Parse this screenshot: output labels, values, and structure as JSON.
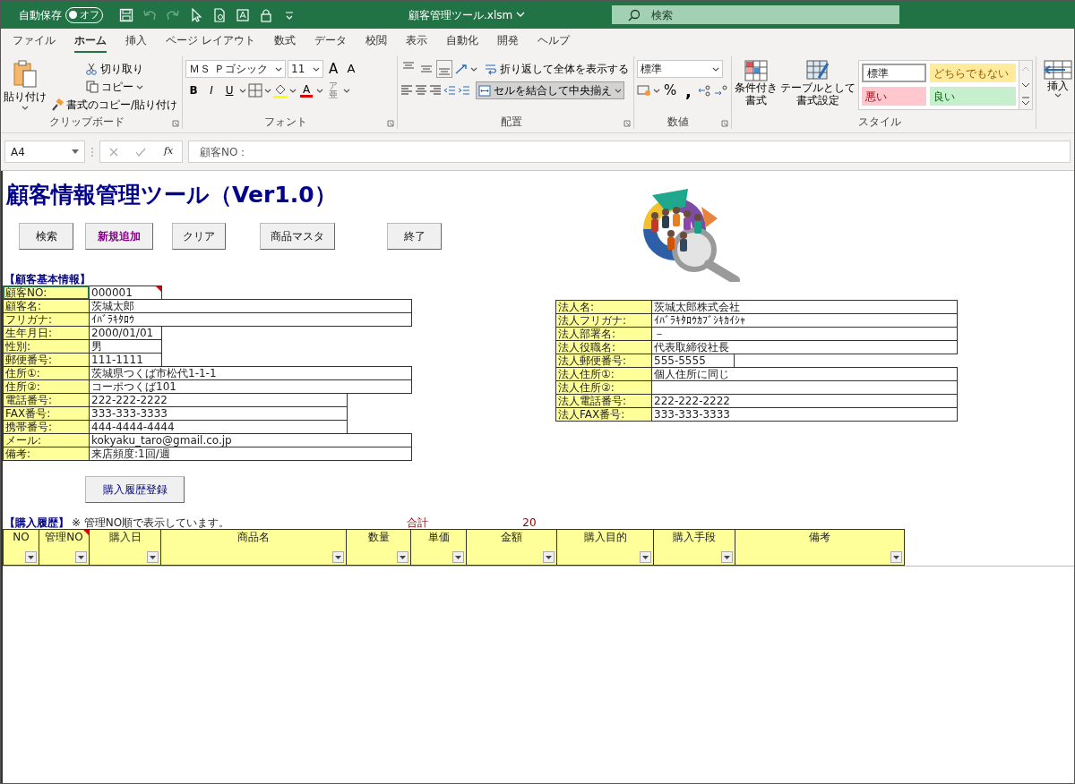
{
  "titlebar": {
    "autosave_label": "自動保存",
    "autosave": {
      "on": false,
      "label": "オフ"
    },
    "filename": "顧客管理ツール.xlsm",
    "search_placeholder": "検索"
  },
  "menu": [
    {
      "label": "ファイル",
      "selected": false
    },
    {
      "label": "ホーム",
      "selected": true
    },
    {
      "label": "挿入",
      "selected": false
    },
    {
      "label": "ページ レイアウト",
      "selected": false
    },
    {
      "label": "数式",
      "selected": false
    },
    {
      "label": "データ",
      "selected": false
    },
    {
      "label": "校閲",
      "selected": false
    },
    {
      "label": "表示",
      "selected": false
    },
    {
      "label": "自動化",
      "selected": false
    },
    {
      "label": "開発",
      "selected": false
    },
    {
      "label": "ヘルプ",
      "selected": false
    }
  ],
  "ribbon": {
    "clipboard": {
      "paste": "貼り付け",
      "cut": "切り取り",
      "copy": "コピー",
      "format_painter": "書式のコピー/貼り付け",
      "group": "クリップボード"
    },
    "font": {
      "name": "ＭＳ Ｐゴシック",
      "size": "11",
      "grow": "A",
      "shrink": "A",
      "bold": "B",
      "italic": "I",
      "underline": "U",
      "color_glyph": "A",
      "phonetic": [
        "ア",
        "亜"
      ],
      "group": "フォント"
    },
    "alignment": {
      "vertical": [
        {
          "kind": "top",
          "selected": false
        },
        {
          "kind": "middle",
          "selected": false
        },
        {
          "kind": "bottom",
          "selected": true
        }
      ],
      "wrap": "折り返して全体を表示する",
      "merge": {
        "label": "セルを結合して中央揃え",
        "selected": true
      },
      "group": "配置"
    },
    "number": {
      "format": "標準",
      "percent": "%",
      "comma": ",",
      "group": "数値"
    },
    "styles": {
      "conditional": [
        "条件付き",
        "書式"
      ],
      "table": [
        "テーブルとして",
        "書式設定"
      ],
      "cells": [
        {
          "label": "標準",
          "kind": "normal"
        },
        {
          "label": "どちらでもない",
          "kind": "neutral"
        },
        {
          "label": "悪い",
          "kind": "bad"
        },
        {
          "label": "良い",
          "kind": "good"
        }
      ],
      "group": "スタイル"
    },
    "cells": {
      "insert": "挿入"
    }
  },
  "formula_bar": {
    "name_box": "A4",
    "fx": "fx",
    "formula": "顧客NO："
  },
  "sheet": {
    "title": "顧客情報管理ツール（Ver1.0）",
    "buttons": [
      {
        "label": "検索",
        "emphasis": false
      },
      {
        "label": "新規追加",
        "emphasis": true
      },
      {
        "label": "クリア",
        "emphasis": false
      },
      {
        "label": "商品マスタ",
        "emphasis": false
      },
      {
        "label": "終了",
        "emphasis": false
      }
    ],
    "customer_heading": "【顧客基本情報】",
    "customer": [
      {
        "label": "顧客NO:",
        "value": "000001",
        "kind": "short",
        "selected": true,
        "has_comment": true
      },
      {
        "label": "顧客名:",
        "value": "茨城太郎",
        "kind": "full",
        "selected": false,
        "has_comment": false
      },
      {
        "label": "フリガナ:",
        "value": "ｲﾊﾞﾗｷﾀﾛｳ",
        "kind": "full",
        "selected": false,
        "has_comment": false
      },
      {
        "label": "生年月日:",
        "value": " 2000/01/01",
        "kind": "short",
        "selected": false,
        "has_comment": false
      },
      {
        "label": "性別:",
        "value": "男",
        "kind": "short",
        "selected": false,
        "has_comment": false
      },
      {
        "label": "郵便番号:",
        "value": "111-1111",
        "kind": "short",
        "selected": false,
        "has_comment": false
      },
      {
        "label": "住所①:",
        "value": "茨城県つくば市松代1-1-1",
        "kind": "full",
        "selected": false,
        "has_comment": false
      },
      {
        "label": "住所②:",
        "value": "コーポつくば101",
        "kind": "full",
        "selected": false,
        "has_comment": false
      },
      {
        "label": "電話番号:",
        "value": "222-222-2222",
        "kind": "medium",
        "selected": false,
        "has_comment": false
      },
      {
        "label": "FAX番号:",
        "value": "333-333-3333",
        "kind": "medium",
        "selected": false,
        "has_comment": false
      },
      {
        "label": "携帯番号:",
        "value": "444-4444-4444",
        "kind": "medium",
        "selected": false,
        "has_comment": false
      },
      {
        "label": "メール:",
        "value": "kokyaku_taro@gmail.co.jp",
        "kind": "full",
        "selected": false,
        "has_comment": false
      },
      {
        "label": "備考:",
        "value": "来店頻度:1回/週",
        "kind": "full",
        "selected": false,
        "has_comment": false
      }
    ],
    "corporate": [
      {
        "label": "法人名:",
        "value": "茨城太郎株式会社",
        "kind": "full"
      },
      {
        "label": "法人フリガナ:",
        "value": "ｲﾊﾞﾗｷﾀﾛｳｶﾌﾞｼｷｶｲｼｬ",
        "kind": "full"
      },
      {
        "label": "法人部署名:",
        "value": "－",
        "kind": "full"
      },
      {
        "label": "法人役職名:",
        "value": "代表取締役社長",
        "kind": "full"
      },
      {
        "label": "法人郵便番号:",
        "value": "555-5555",
        "kind": "short"
      },
      {
        "label": "法人住所①:",
        "value": "個人住所に同じ",
        "kind": "full"
      },
      {
        "label": "法人住所②:",
        "kind": "full"
      },
      {
        "label": "法人電話番号:",
        "value": "222-222-2222",
        "kind": "full"
      },
      {
        "label": "法人FAX番号:",
        "value": "333-333-3333",
        "kind": "full"
      }
    ],
    "register_button": "購入履歴登録",
    "history_heading": "【購入履歴】",
    "history_note": "※ 管理NO順で表示しています。",
    "total": {
      "label": "合計",
      "value": "20"
    },
    "columns": [
      {
        "label": "NO",
        "has_comment": false
      },
      {
        "label": "管理NO",
        "has_comment": true
      },
      {
        "label": "購入日",
        "has_comment": false
      },
      {
        "label": "商品名",
        "has_comment": false
      },
      {
        "label": "数量",
        "has_comment": false
      },
      {
        "label": "単価",
        "has_comment": false
      },
      {
        "label": "金額",
        "has_comment": false
      },
      {
        "label": "購入目的",
        "has_comment": false
      },
      {
        "label": "購入手段",
        "has_comment": false
      },
      {
        "label": "備考",
        "has_comment": false
      }
    ]
  }
}
